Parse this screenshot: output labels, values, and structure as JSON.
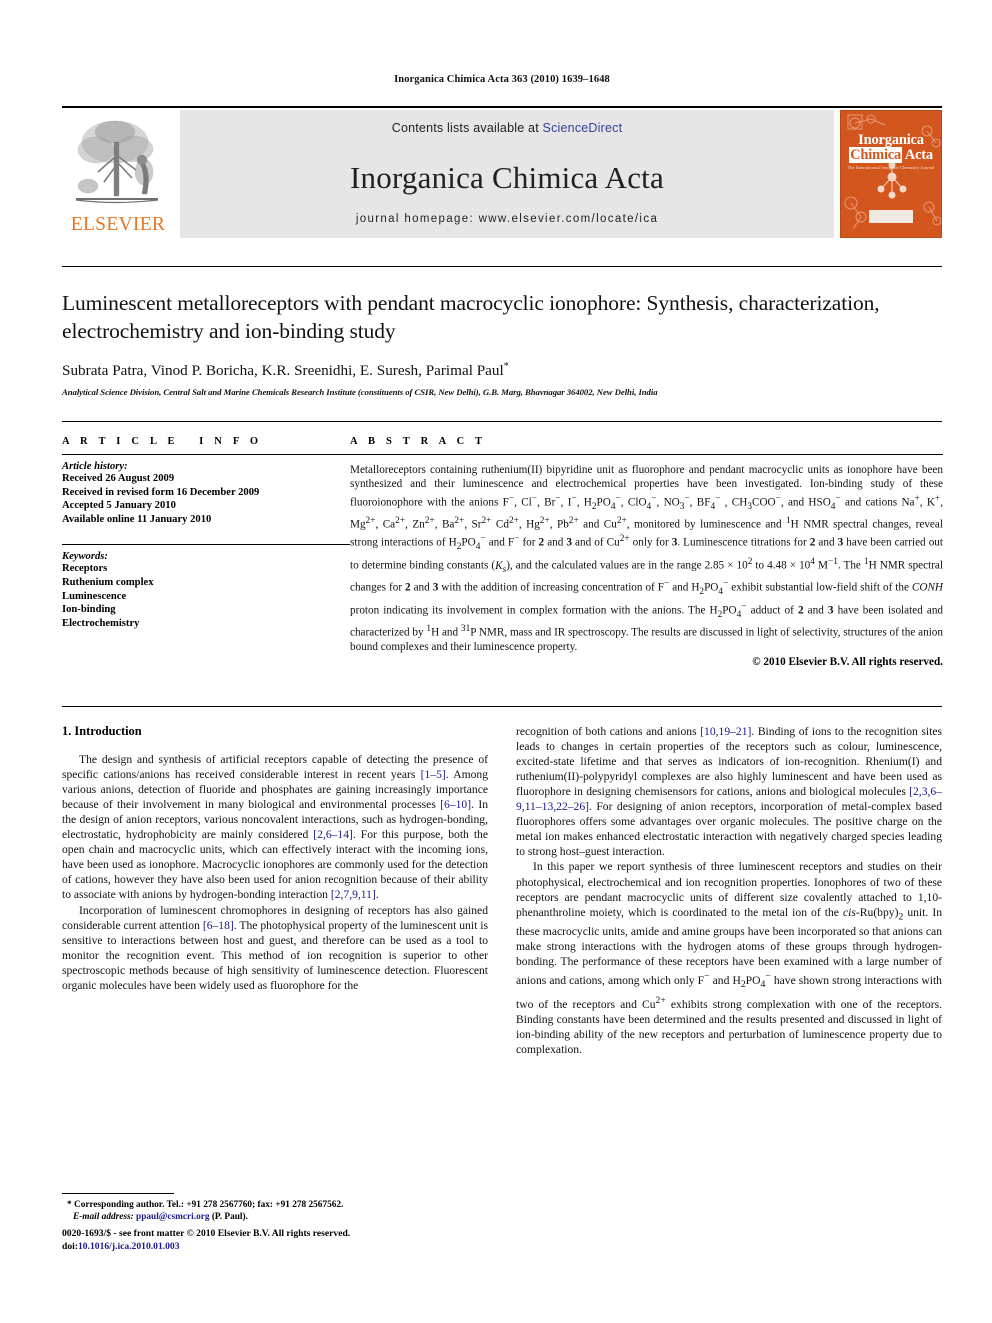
{
  "running_head": "Inorganica Chimica Acta 363 (2010) 1639–1648",
  "masthead": {
    "publisher_name": "ELSEVIER",
    "contents_prefix": "Contents lists available at ",
    "contents_link": "ScienceDirect",
    "journal_title": "Inorganica Chimica Acta",
    "homepage": "journal homepage: www.elsevier.com/locate/ica",
    "cover": {
      "line1": "Inorganica",
      "line2_a": "Chimica",
      "line2_b": "Acta",
      "subtitle": "The International Inorganic Chemistry Journal"
    }
  },
  "article": {
    "title": "Luminescent metalloreceptors with pendant macrocyclic ionophore: Synthesis, characterization, electrochemistry and ion-binding study",
    "authors": "Subrata Patra, Vinod P. Boricha, K.R. Sreenidhi, E. Suresh, Parimal Paul",
    "author_marker": "*",
    "affiliation": "Analytical Science Division, Central Salt and Marine Chemicals Research Institute (constituents of CSIR, New Delhi), G.B. Marg, Bhavnagar 364002, New Delhi, India"
  },
  "info": {
    "heading": "ARTICLE INFO",
    "history_label": "Article history:",
    "history": [
      "Received 26 August 2009",
      "Received in revised form 16 December 2009",
      "Accepted 5 January 2010",
      "Available online 11 January 2010"
    ],
    "keywords_label": "Keywords:",
    "keywords": [
      "Receptors",
      "Ruthenium complex",
      "Luminescence",
      "Ion-binding",
      "Electrochemistry"
    ]
  },
  "abstract": {
    "heading": "ABSTRACT",
    "copyright": "© 2010 Elsevier B.V. All rights reserved."
  },
  "sections": {
    "introduction_heading": "1. Introduction"
  },
  "footnote": {
    "marker": "*",
    "corresponding": "Corresponding author. Tel.: +91 278 2567760; fax: +91 278 2567562.",
    "email_label": "E-mail address:",
    "email": "ppaul@csmcri.org",
    "email_suffix": "(P. Paul)."
  },
  "bottom": {
    "issn_line": "0020-1693/$ - see front matter © 2010 Elsevier B.V. All rights reserved.",
    "doi_label": "doi:",
    "doi": "10.1016/j.ica.2010.01.003"
  },
  "colors": {
    "elsevier_orange": "#E87722",
    "cover_orange": "#D2561E",
    "link_blue": "#1a1a8c",
    "sciencedirect_blue": "#3b3b9e",
    "band_grey": "#e6e6e6"
  }
}
